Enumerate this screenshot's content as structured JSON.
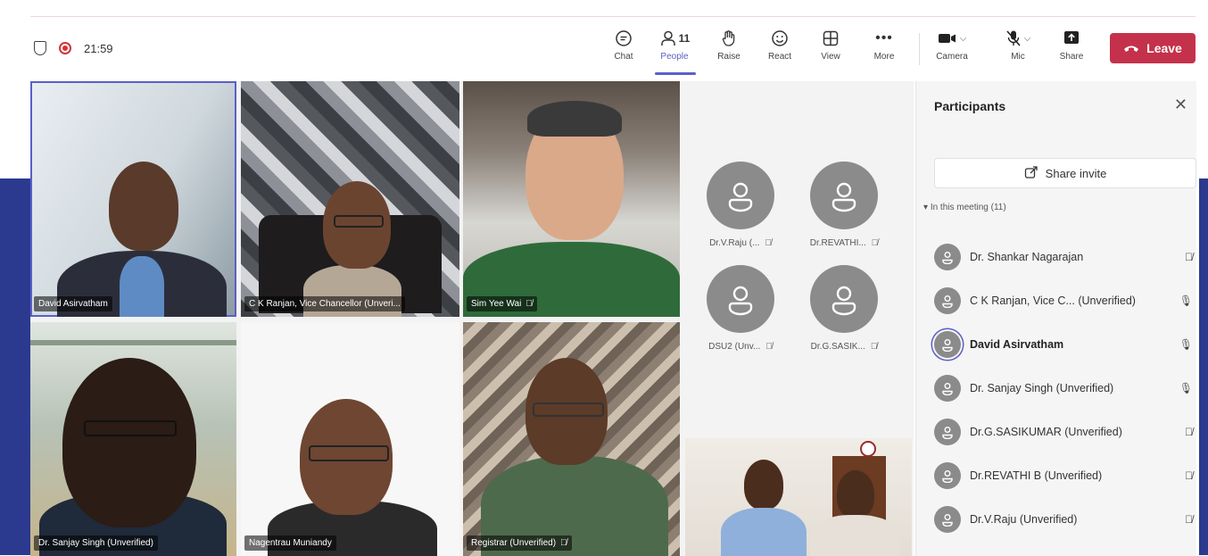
{
  "toolbar": {
    "timer": "21:59",
    "buttons": [
      {
        "id": "chat",
        "label": "Chat",
        "icon": "chat-icon"
      },
      {
        "id": "people",
        "label": "People",
        "icon": "people-icon",
        "badge": "11"
      },
      {
        "id": "raise",
        "label": "Raise",
        "icon": "hand-icon"
      },
      {
        "id": "react",
        "label": "React",
        "icon": "smiley-icon"
      },
      {
        "id": "view",
        "label": "View",
        "icon": "grid-icon"
      },
      {
        "id": "more",
        "label": "More",
        "icon": "ellipsis-icon"
      },
      {
        "id": "camera",
        "label": "Camera",
        "icon": "camera-icon"
      },
      {
        "id": "mic",
        "label": "Mic",
        "icon": "mic-off-icon"
      },
      {
        "id": "share",
        "label": "Share",
        "icon": "share-tray-icon"
      }
    ],
    "leave_label": "Leave",
    "leave_color": "#c4314b",
    "accent_color": "#5b5fc7"
  },
  "tiles": {
    "t1": {
      "name": "David Asirvatham"
    },
    "t2": {
      "name": "C K Ranjan, Vice Chancellor (Unveri..."
    },
    "t3": {
      "name": "Sim Yee Wai"
    },
    "t4": {
      "name": "Dr. Sanjay Singh (Unverified)"
    },
    "t5": {
      "name": "Nagentrau Muniandy"
    },
    "t6": {
      "name": "Registrar (Unverified)"
    }
  },
  "avatars": [
    {
      "label": "Dr.V.Raju (..."
    },
    {
      "label": "Dr.REVATHI..."
    },
    {
      "label": "DSU2 (Unv..."
    },
    {
      "label": "Dr.G.SASIK..."
    }
  ],
  "panel": {
    "title": "Participants",
    "share_invite": "Share invite",
    "section": "In this meeting (11)",
    "participants": [
      {
        "name": "Dr. Shankar Nagarajan",
        "mic": "muted"
      },
      {
        "name": "C K Ranjan, Vice C... (Unverified)",
        "mic": "on"
      },
      {
        "name": "David Asirvatham",
        "mic": "on"
      },
      {
        "name": "Dr. Sanjay Singh (Unverified)",
        "mic": "on"
      },
      {
        "name": "Dr.G.SASIKUMAR (Unverified)",
        "mic": "muted"
      },
      {
        "name": "Dr.REVATHI B (Unverified)",
        "mic": "muted"
      },
      {
        "name": "Dr.V.Raju (Unverified)",
        "mic": "muted"
      }
    ]
  }
}
